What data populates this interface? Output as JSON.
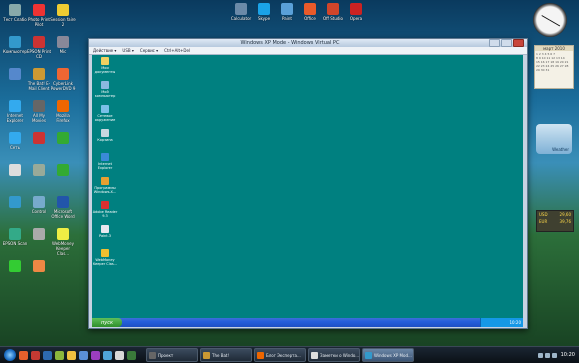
{
  "desktop_left_icons": [
    {
      "label": "Тест Слабо",
      "name": "desktop-icon-test"
    },
    {
      "label": "Photo Print Pilot",
      "name": "desktop-icon-photo-print-pilot"
    },
    {
      "label": "Session faire 2",
      "name": "desktop-icon-session"
    },
    {
      "label": "Компьютер",
      "name": "desktop-icon-computer"
    },
    {
      "label": "EPSON Print CD",
      "name": "desktop-icon-epson-print-cd"
    },
    {
      "label": "Mic",
      "name": "desktop-icon-mic"
    },
    {
      "label": "",
      "name": "desktop-icon-1"
    },
    {
      "label": "The Bat! E-Mail Client",
      "name": "desktop-icon-thebat"
    },
    {
      "label": "CyberLink PowerDVD 9",
      "name": "desktop-icon-powerdvd"
    },
    {
      "label": "Internet Explorer",
      "name": "desktop-icon-ie"
    },
    {
      "label": "All My Movies",
      "name": "desktop-icon-all-my-movies"
    },
    {
      "label": "Mozilla Firefox",
      "name": "desktop-icon-firefox"
    },
    {
      "label": "Сеть",
      "name": "desktop-icon-network"
    },
    {
      "label": "",
      "name": "desktop-icon-2"
    },
    {
      "label": "",
      "name": "desktop-icon-3"
    },
    {
      "label": "",
      "name": "desktop-icon-4"
    },
    {
      "label": "",
      "name": "desktop-icon-5"
    },
    {
      "label": "",
      "name": "desktop-icon-6"
    },
    {
      "label": "",
      "name": "desktop-icon-7"
    },
    {
      "label": "Control",
      "name": "desktop-icon-control"
    },
    {
      "label": "Microsoft Office Word",
      "name": "desktop-icon-word"
    },
    {
      "label": "EPSON Scan",
      "name": "desktop-icon-epson-scan"
    },
    {
      "label": "",
      "name": "desktop-icon-8"
    },
    {
      "label": "WebMoney Keeper Clas...",
      "name": "desktop-icon-webmoney"
    },
    {
      "label": "",
      "name": "desktop-icon-9"
    },
    {
      "label": "",
      "name": "desktop-icon-10"
    }
  ],
  "desktop_top_icons": [
    {
      "label": "Calculator",
      "name": "top-icon-calculator"
    },
    {
      "label": "Skype",
      "name": "top-icon-skype"
    },
    {
      "label": "Paint",
      "name": "top-icon-paint"
    },
    {
      "label": "Office",
      "name": "top-icon-office"
    },
    {
      "label": "Off Studio",
      "name": "top-icon-off-studio"
    },
    {
      "label": "Opera",
      "name": "top-icon-opera"
    }
  ],
  "vm": {
    "title": "Windows XP Mode - Windows Virtual PC",
    "menu": [
      "Действие ▾",
      "USB ▾",
      "Сервис ▾",
      "Ctrl+Alt+Del"
    ],
    "desktop_icons": [
      {
        "label": "Мои документы",
        "name": "xp-icon-my-documents"
      },
      {
        "label": "Мой компьютер",
        "name": "xp-icon-my-computer"
      },
      {
        "label": "Сетевое окружение",
        "name": "xp-icon-network"
      },
      {
        "label": "Корзина",
        "name": "xp-icon-recycle-bin"
      },
      {
        "label": "Internet Explorer",
        "name": "xp-icon-ie"
      },
      {
        "label": "Программы Windows-X...",
        "name": "xp-icon-programs"
      },
      {
        "label": "Adobe Reader 9.3",
        "name": "xp-icon-adobe-reader"
      },
      {
        "label": "Paint.3",
        "name": "xp-icon-paint"
      },
      {
        "label": "WebMoney Keeper Clas...",
        "name": "xp-icon-webmoney"
      }
    ],
    "start_label": "пуск",
    "tray_time": "10:20"
  },
  "gadgets": {
    "calendar_month": "март 2010",
    "weather_label": "Weather",
    "currency_rows": [
      [
        "USD",
        "29,60"
      ],
      [
        "EUR",
        "39,76"
      ]
    ]
  },
  "taskbar": {
    "buttons": [
      {
        "label": "Проект",
        "name": "taskbar-btn-project",
        "active": false
      },
      {
        "label": "The Bat!",
        "name": "taskbar-btn-thebat",
        "active": false
      },
      {
        "label": "Блог Эксперта...",
        "name": "taskbar-btn-blog",
        "active": false
      },
      {
        "label": "Заметки о Windo...",
        "name": "taskbar-btn-notes",
        "active": false
      },
      {
        "label": "Windows XP Mod...",
        "name": "taskbar-btn-xpmode",
        "active": true
      }
    ],
    "clock": "10:20"
  }
}
